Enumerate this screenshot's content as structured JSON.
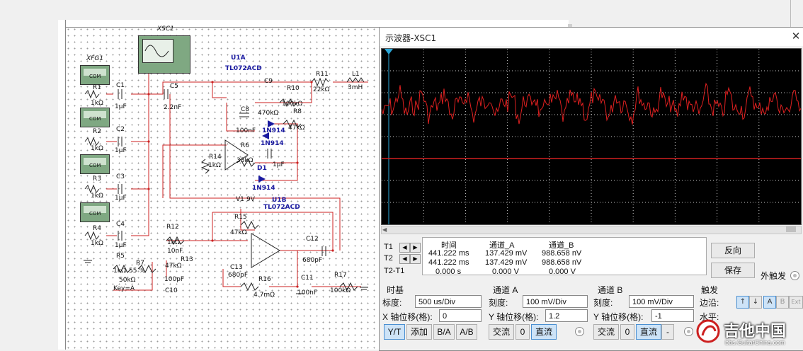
{
  "window": {
    "title": "示波器-XSC1",
    "close_glyph": "✕"
  },
  "schematic": {
    "scope_label": "XSC1",
    "fg_label": "XFG1",
    "com_label": "COM",
    "u1a": "U1A",
    "u1a_part": "TL072ACD",
    "u1b": "U1B",
    "u1b_part": "TL072ACD",
    "components": {
      "R1": "R1",
      "R1v": "1kΩ",
      "R2": "R2",
      "R2v": "1kΩ",
      "R3": "R3",
      "R3v": "1kΩ",
      "R4": "R4",
      "R4v": "1kΩ",
      "C1": "C1",
      "C1v": "1µF",
      "C2": "C2",
      "C2v": "1µF",
      "C3": "C3",
      "C3v": "1µF",
      "C4": "C4",
      "C4v": "1µF",
      "C5": "C5",
      "C5v": "2.2nF",
      "C8": "C8",
      "C8v": "100nF",
      "C9": "C9",
      "R9v": "470kΩ",
      "R10": "R10",
      "R10v": "100kΩ",
      "R11": "R11",
      "R11v": "22kΩ",
      "L1": "L1",
      "L1v": "3mH",
      "R8": "R8",
      "R8v": "47kΩ",
      "D2v": "1N914",
      "D3v": "1N914",
      "R6": "R6",
      "R6v": "33kΩ",
      "R14": "R14",
      "R14v": "1kΩ",
      "C1b": "1µF",
      "D1": "D1",
      "D1v": "1N914",
      "V1": "V1",
      "V1v": "9V",
      "R15": "R15",
      "R15v": "47kΩ",
      "R12": "R12",
      "R12v": "1kΩ",
      "C6v": "10nF",
      "R13": "R13",
      "R13v": "47kΩ",
      "C10v": "100pF",
      "C10": "C10",
      "C13": "C13",
      "C13v": "680pF",
      "R16": "R16",
      "R16v": "4.7mΩ",
      "C12": "C12",
      "C12v": "680pF",
      "C11": "C11",
      "C11v": "100nF",
      "R17": "R17",
      "R17v": "100kΩ",
      "R5": "R5",
      "R5v": "1kΩ",
      "R7": "R7",
      "R7pct": "55 %",
      "R7v": "50kΩ",
      "key": "Key=A"
    }
  },
  "readout": {
    "h_time": "时间",
    "h_cha": "通道_A",
    "h_chb": "通道_B",
    "rows": [
      {
        "label": "T1",
        "time": "441.222 ms",
        "a": "137.429 mV",
        "b": "988.658 nV"
      },
      {
        "label": "T2",
        "time": "441.222 ms",
        "a": "137.429 mV",
        "b": "988.658 nV"
      },
      {
        "label": "T2-T1",
        "time": "0.000 s",
        "a": "0.000 V",
        "b": "0.000 V"
      }
    ],
    "reverse": "反向",
    "save": "保存",
    "ext_trigger": "外触发"
  },
  "timebase": {
    "title": "时基",
    "scale_label": "标度:",
    "scale": "500 us/Div",
    "xpos_label": "X 轴位移(格):",
    "xpos": "0",
    "btn_yt": "Y/T",
    "btn_add": "添加",
    "btn_ba": "B/A",
    "btn_ab": "A/B"
  },
  "channel_a": {
    "title": "通道 A",
    "scale_label": "刻度:",
    "scale": "100 mV/Div",
    "ypos_label": "Y 轴位移(格):",
    "ypos": "1.2",
    "btn_ac": "交流",
    "btn_zero": "0",
    "btn_dc": "直流"
  },
  "channel_b": {
    "title": "通道 B",
    "scale_label": "刻度:",
    "scale": "100 mV/Div",
    "ypos_label": "Y 轴位移(格):",
    "ypos": "-1",
    "btn_ac": "交流",
    "btn_zero": "0",
    "btn_dc": "直流",
    "btn_minus": "-"
  },
  "trigger": {
    "title": "触发",
    "edge_label": "边沿:",
    "level_label": "水平:",
    "btn_a": "A",
    "btn_b": "B",
    "btn_ext": "Ext",
    "single": "单"
  },
  "watermark": {
    "text": "吉他中国",
    "url": "bbs.GuitarChina.com"
  },
  "colors": {
    "trace_a": "#e02020",
    "trace_b": "#d02020",
    "grid": "#c8c8c8",
    "wire": "#cc2222"
  }
}
